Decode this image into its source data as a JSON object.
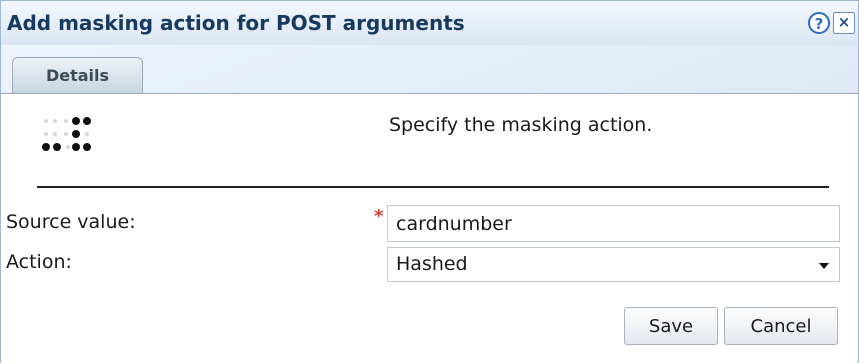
{
  "dialog": {
    "title": "Add masking action for POST arguments",
    "help_label": "?",
    "close_label": "×",
    "icon": "masking-dots-icon"
  },
  "tabs": [
    {
      "label": "Details",
      "active": true
    }
  ],
  "details": {
    "instruction": "Specify the masking action."
  },
  "form": {
    "source_value": {
      "label": "Source value:",
      "required_marker": "*",
      "value": "cardnumber"
    },
    "action": {
      "label": "Action:",
      "selected": "Hashed"
    }
  },
  "buttons": {
    "save_label": "Save",
    "cancel_label": "Cancel"
  },
  "colors": {
    "title_text": "#17385f",
    "required_marker": "#e03a3a",
    "help_accent": "#2a6cc7"
  }
}
